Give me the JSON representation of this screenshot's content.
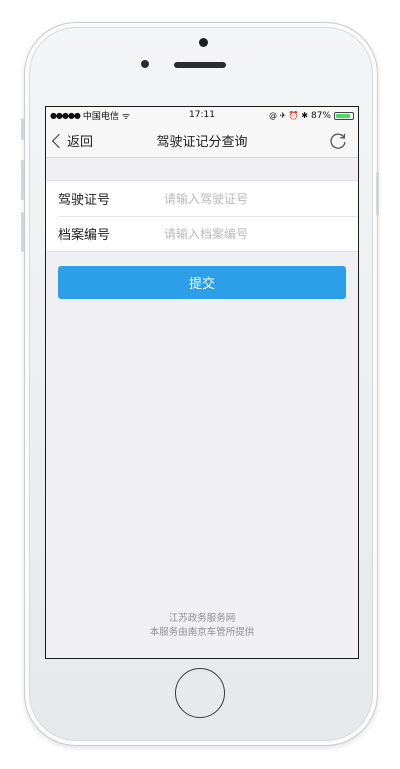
{
  "status_bar": {
    "signal_dots": "●●●●●",
    "carrier": "中国电信",
    "wifi_glyph": "ᯤ",
    "time": "17:11",
    "icons_glyph": "@ ✈ ⏰ ✱",
    "battery_percent": "87%",
    "battery_level": 0.87
  },
  "nav": {
    "back_label": "返回",
    "title": "驾驶证记分查询",
    "refresh_icon": "refresh-icon"
  },
  "form": {
    "license_label": "驾驶证号",
    "license_placeholder": "请输入驾驶证号",
    "license_value": "",
    "file_label": "档案编号",
    "file_placeholder": "请输入档案编号",
    "file_value": ""
  },
  "submit_label": "提交",
  "footer": {
    "line1": "江苏政务服务网",
    "line2": "本服务由南京车管所提供"
  },
  "colors": {
    "accent": "#2d9ee8",
    "background": "#efeff4",
    "battery": "#4cd964"
  }
}
